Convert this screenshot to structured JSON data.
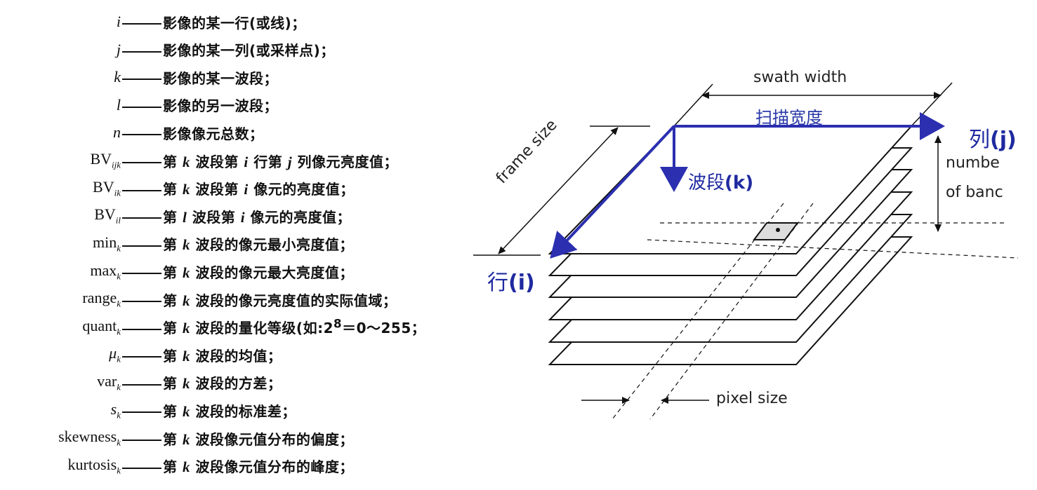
{
  "definitions": [
    {
      "term_html": "<span class='it'>i</span>",
      "text": "影像的某一行(或线)；"
    },
    {
      "term_html": "<span class='it'>j</span>",
      "text": "影像的某一列(或采样点)；"
    },
    {
      "term_html": "<span class='it'>k</span>",
      "text": "影像的某一波段；"
    },
    {
      "term_html": "<span class='it'>l</span>",
      "text": "影像的另一波段；"
    },
    {
      "term_html": "<span class='it'>n</span>",
      "text": "影像像元总数；"
    },
    {
      "term_html": "BV<sub>ijk</sub>",
      "text_html": "第 <span class='it'>k</span> 波段第 <span class='it'>i</span> 行第 <span class='it'>j</span> 列像元亮度值；"
    },
    {
      "term_html": "BV<sub>ik</sub>",
      "text_html": "第 <span class='it'>k</span> 波段第 <span class='it'>i</span> 像元的亮度值；"
    },
    {
      "term_html": "BV<sub>il</sub>",
      "text_html": "第 <span class='it'>l</span> 波段第 <span class='it'>i</span> 像元的亮度值；"
    },
    {
      "term_html": "min<sub>k</sub>",
      "text_html": "第 <span class='it'>k</span> 波段的像元最小亮度值；"
    },
    {
      "term_html": "max<sub>k</sub>",
      "text_html": "第 <span class='it'>k</span> 波段的像元最大亮度值；"
    },
    {
      "term_html": "range<sub>k</sub>",
      "text_html": "第 <span class='it'>k</span> 波段的像元亮度值的实际值域；"
    },
    {
      "term_html": "quant<sub>k</sub>",
      "text_html": "第 <span class='it'>k</span> 波段的量化等级(如:2<sup>8</sup>＝0～255；"
    },
    {
      "term_html": "<span class='it'>μ</span><sub>k</sub>",
      "text_html": "第 <span class='it'>k</span> 波段的均值；"
    },
    {
      "term_html": "var<sub>k</sub>",
      "text_html": "第 <span class='it'>k</span> 波段的方差；"
    },
    {
      "term_html": "<span class='it'>s</span><sub>k</sub>",
      "text_html": "第 <span class='it'>k</span> 波段的标准差；"
    },
    {
      "term_html": "skewness<sub>k</sub>",
      "text_html": "第 <span class='it'>k</span> 波段像元值分布的偏度；"
    },
    {
      "term_html": "kurtosis<sub>k</sub>",
      "text_html": "第 <span class='it'>k</span> 波段像元值分布的峰度；"
    }
  ],
  "diagram": {
    "swath_width": "swath width",
    "swath_width_cn": "扫描宽度",
    "frame_size": "frame size",
    "pixel_size": "pixel size",
    "number_of_bands_line1": "numbe",
    "number_of_bands_line2": "of banc",
    "col_label_cn": "列",
    "col_label_var": "(j)",
    "row_label_cn": "行",
    "row_label_var": "(i)",
    "band_label_cn": "波段",
    "band_label_var": "(k)",
    "accent_color": "#2b2fb0"
  }
}
